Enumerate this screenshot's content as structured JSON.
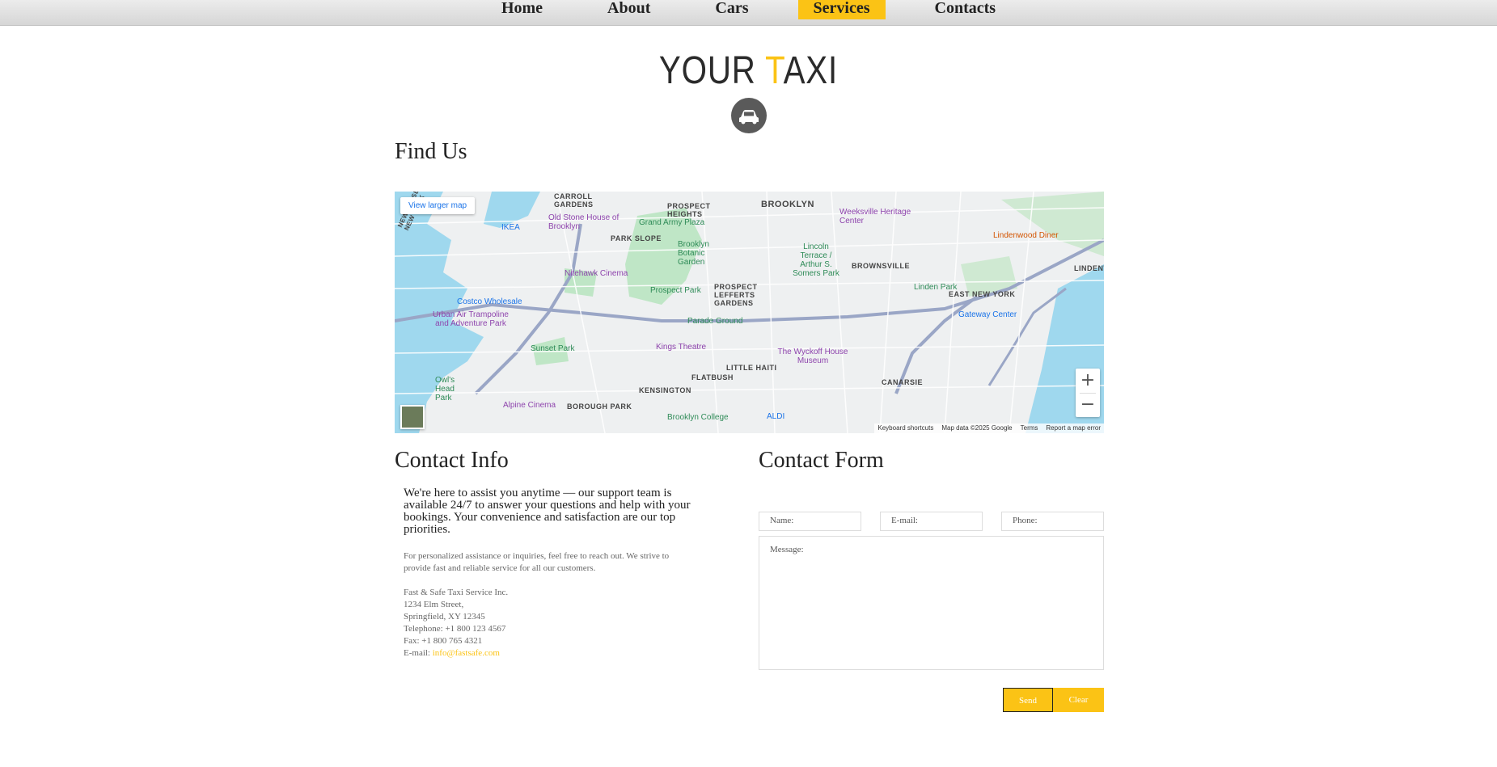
{
  "nav": {
    "items": [
      {
        "label": "Home",
        "active": false
      },
      {
        "label": "About",
        "active": false
      },
      {
        "label": "Cars",
        "active": false
      },
      {
        "label": "Services",
        "active": true
      },
      {
        "label": "Contacts",
        "active": false
      }
    ]
  },
  "logo": {
    "part1": "YOUR ",
    "accent": "T",
    "part2": "AXI",
    "icon": "car-icon",
    "accent_color": "#fbc315"
  },
  "find_us": {
    "title": "Find Us"
  },
  "map": {
    "larger_map_label": "View larger map",
    "zoom_in": "+",
    "zoom_out": "−",
    "footer": {
      "shortcuts": "Keyboard shortcuts",
      "data": "Map data ©2025 Google",
      "terms": "Terms",
      "report": "Report a map error"
    },
    "labels": {
      "brooklyn": "BROOKLYN",
      "prospect_heights": "PROSPECT HEIGHTS",
      "park_slope": "PARK SLOPE",
      "carroll_gardens": "CARROLL GARDENS",
      "brownsville": "BROWNSVILLE",
      "prospect_lefferts": "PROSPECT LEFFERTS GARDENS",
      "little_haiti": "LITTLE HAITI",
      "flatbush": "FLATBUSH",
      "kensington": "KENSINGTON",
      "borough_park": "BOROUGH PARK",
      "canarsie": "CANARSIE",
      "east_new_york": "EAST NEW YORK",
      "lindenwood": "LINDENWOOD",
      "old_stone": "Old Stone House of Brooklyn",
      "grand_army": "Grand Army Plaza",
      "ikea": "IKEA",
      "botanic": "Brooklyn Botanic Garden",
      "nitehawk": "Nitehawk Cinema",
      "prospect_park": "Prospect Park",
      "costco": "Costco Wholesale",
      "urban_air": "Urban Air Trampoline and Adventure Park",
      "parade": "Parade Ground",
      "sunset": "Sunset Park",
      "kings": "Kings Theatre",
      "wyckoff": "The Wyckoff House Museum",
      "weeksville": "Weeksville Heritage Center",
      "lincoln": "Lincoln Terrace / Arthur S. Somers Park",
      "linden_park": "Linden Park",
      "gateway": "Gateway Center",
      "lindenwood_diner": "Lindenwood Diner",
      "alpine": "Alpine Cinema",
      "brooklyn_college": "Brooklyn College",
      "aldi": "ALDI",
      "owls_head": "Owl's Head Park",
      "nj_ny": "NEW JERSEY NEW YORK"
    }
  },
  "contact_info": {
    "title": "Contact Info",
    "lead": "We're here to assist you anytime — our support team is available 24/7 to answer your questions and help with your bookings. Your convenience and satisfaction are our top priorities.",
    "sub": "For personalized assistance or inquiries, feel free to reach out. We strive to provide fast and reliable service for all our customers.",
    "company": "Fast & Safe Taxi Service Inc.",
    "street": "1234 Elm Street,",
    "city": "Springfield, XY 12345",
    "telephone": "Telephone: +1 800 123 4567",
    "fax": "Fax: +1 800 765 4321",
    "email_label": "E-mail: ",
    "email": "info@fastsafe.com"
  },
  "contact_form": {
    "title": "Contact Form",
    "name_placeholder": "Name:",
    "email_placeholder": "E-mail:",
    "phone_placeholder": "Phone:",
    "message_placeholder": "Message:",
    "send_label": "Send",
    "clear_label": "Clear"
  }
}
